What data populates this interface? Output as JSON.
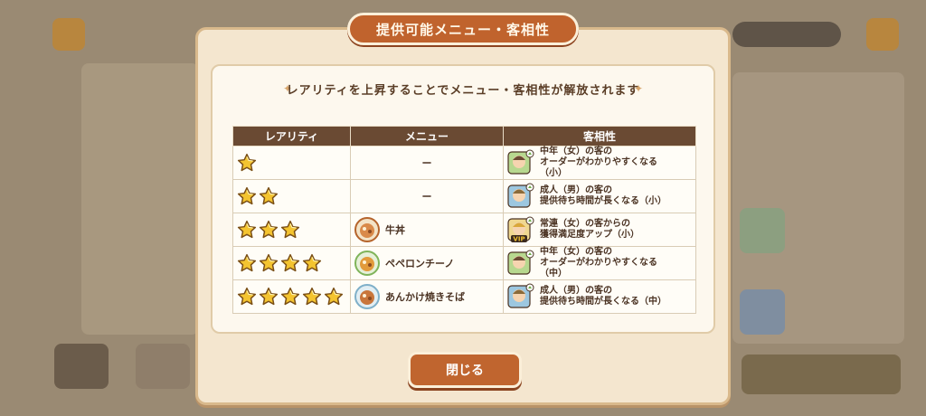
{
  "dialog": {
    "title": "提供可能メニュー・客相性",
    "subtitle": "レアリティを上昇することでメニュー・客相性が解放されます",
    "close_label": "閉じる"
  },
  "table": {
    "headers": [
      "レアリティ",
      "メニュー",
      "客相性"
    ],
    "rows": [
      {
        "stars": 1,
        "menu": "ー",
        "menu_icon": "",
        "compat": "中年（女）の客の\nオーダーがわかりやすくなる\n（小）",
        "customer_icon": "middle-aged-woman-icon",
        "badge": ""
      },
      {
        "stars": 2,
        "menu": "ー",
        "menu_icon": "",
        "compat": "成人（男）の客の\n提供待ち時間が長くなる（小）",
        "customer_icon": "adult-man-icon",
        "badge": ""
      },
      {
        "stars": 3,
        "menu": "牛丼",
        "menu_icon": "gyudon-bowl-icon",
        "compat": "常連（女）の客からの\n獲得満足度アップ（小）",
        "customer_icon": "regular-woman-icon",
        "badge": "VIP"
      },
      {
        "stars": 4,
        "menu": "ペペロンチーノ",
        "menu_icon": "peperoncino-plate-icon",
        "compat": "中年（女）の客の\nオーダーがわかりやすくなる\n（中）",
        "customer_icon": "middle-aged-woman-icon",
        "badge": ""
      },
      {
        "stars": 5,
        "menu": "あんかけ焼きそば",
        "menu_icon": "ankake-yakisoba-plate-icon",
        "compat": "成人（男）の客の\n提供待ち時間が長くなる（中）",
        "customer_icon": "adult-man-icon",
        "badge": ""
      }
    ]
  },
  "colors": {
    "banner": "#c0632d",
    "header": "#6a4a33",
    "star": "#f4c430",
    "button": "#c0652f"
  }
}
